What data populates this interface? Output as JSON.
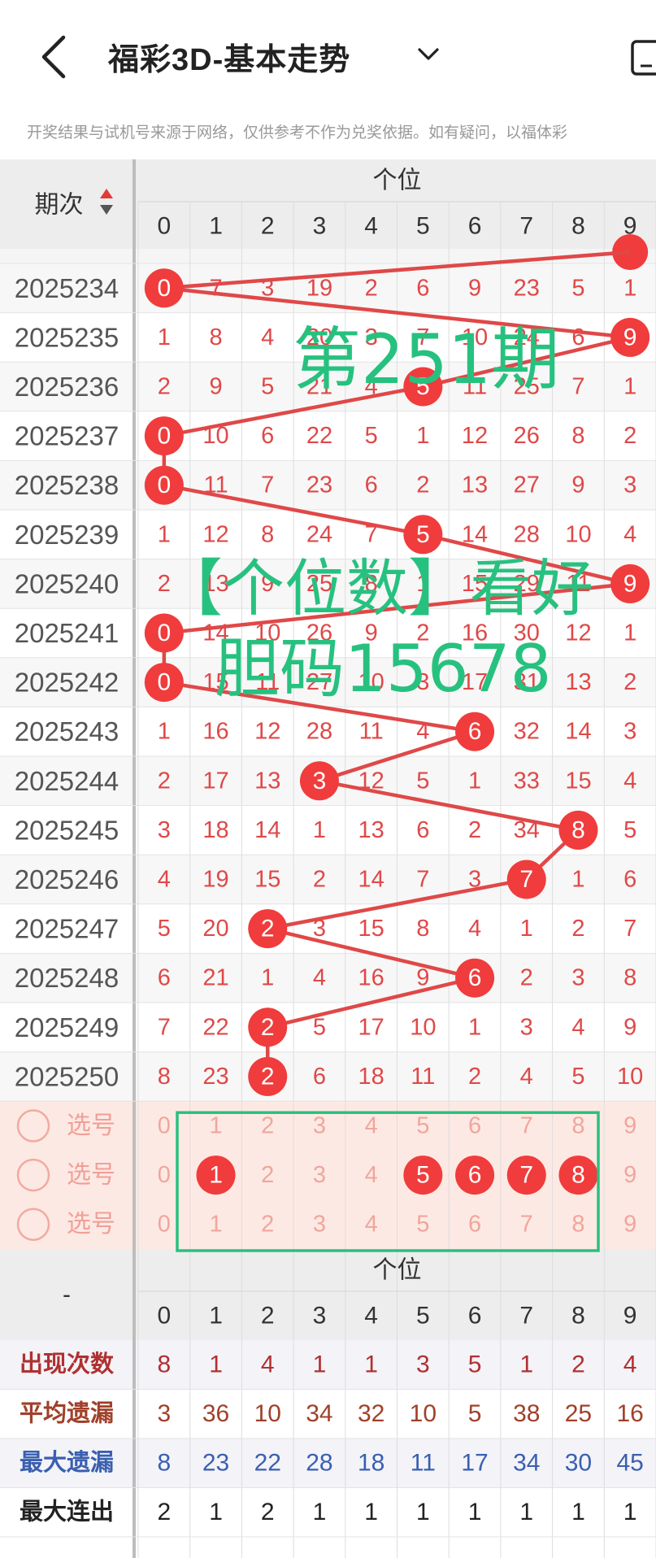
{
  "header": {
    "title": "福彩3D-基本走势",
    "disclaimer": "开奖结果与试机号来源于网络，仅供参考不作为兑奖依据。如有疑问，以福体彩"
  },
  "table": {
    "period_label": "期次",
    "group_label": "个位",
    "digits": [
      "0",
      "1",
      "2",
      "3",
      "4",
      "5",
      "6",
      "7",
      "8",
      "9"
    ],
    "rows": [
      {
        "period": "2025234",
        "cells": [
          "0",
          "7",
          "3",
          "19",
          "2",
          "6",
          "9",
          "23",
          "5",
          "1"
        ],
        "hit": 0
      },
      {
        "period": "2025235",
        "cells": [
          "1",
          "8",
          "4",
          "20",
          "3",
          "7",
          "10",
          "24",
          "6",
          "9"
        ],
        "hit": 9
      },
      {
        "period": "2025236",
        "cells": [
          "2",
          "9",
          "5",
          "21",
          "4",
          "5",
          "11",
          "25",
          "7",
          "1"
        ],
        "hit": 5
      },
      {
        "period": "2025237",
        "cells": [
          "0",
          "10",
          "6",
          "22",
          "5",
          "1",
          "12",
          "26",
          "8",
          "2"
        ],
        "hit": 0
      },
      {
        "period": "2025238",
        "cells": [
          "0",
          "11",
          "7",
          "23",
          "6",
          "2",
          "13",
          "27",
          "9",
          "3"
        ],
        "hit": 0
      },
      {
        "period": "2025239",
        "cells": [
          "1",
          "12",
          "8",
          "24",
          "7",
          "5",
          "14",
          "28",
          "10",
          "4"
        ],
        "hit": 5
      },
      {
        "period": "2025240",
        "cells": [
          "2",
          "13",
          "9",
          "25",
          "8",
          "1",
          "15",
          "29",
          "11",
          "9"
        ],
        "hit": 9
      },
      {
        "period": "2025241",
        "cells": [
          "0",
          "14",
          "10",
          "26",
          "9",
          "2",
          "16",
          "30",
          "12",
          "1"
        ],
        "hit": 0
      },
      {
        "period": "2025242",
        "cells": [
          "0",
          "15",
          "11",
          "27",
          "10",
          "3",
          "17",
          "31",
          "13",
          "2"
        ],
        "hit": 0
      },
      {
        "period": "2025243",
        "cells": [
          "1",
          "16",
          "12",
          "28",
          "11",
          "4",
          "6",
          "32",
          "14",
          "3"
        ],
        "hit": 6
      },
      {
        "period": "2025244",
        "cells": [
          "2",
          "17",
          "13",
          "3",
          "12",
          "5",
          "1",
          "33",
          "15",
          "4"
        ],
        "hit": 3
      },
      {
        "period": "2025245",
        "cells": [
          "3",
          "18",
          "14",
          "1",
          "13",
          "6",
          "2",
          "34",
          "8",
          "5"
        ],
        "hit": 8
      },
      {
        "period": "2025246",
        "cells": [
          "4",
          "19",
          "15",
          "2",
          "14",
          "7",
          "3",
          "7",
          "1",
          "6"
        ],
        "hit": 7
      },
      {
        "period": "2025247",
        "cells": [
          "5",
          "20",
          "2",
          "3",
          "15",
          "8",
          "4",
          "1",
          "2",
          "7"
        ],
        "hit": 2
      },
      {
        "period": "2025248",
        "cells": [
          "6",
          "21",
          "1",
          "4",
          "16",
          "9",
          "6",
          "2",
          "3",
          "8"
        ],
        "hit": 6
      },
      {
        "period": "2025249",
        "cells": [
          "7",
          "22",
          "2",
          "5",
          "17",
          "10",
          "1",
          "3",
          "4",
          "9"
        ],
        "hit": 2
      },
      {
        "period": "2025250",
        "cells": [
          "8",
          "23",
          "2",
          "6",
          "18",
          "11",
          "2",
          "4",
          "5",
          "10"
        ],
        "hit": 2
      }
    ],
    "select_label": "选号",
    "select_rows": [
      {
        "picked": []
      },
      {
        "picked": [
          1,
          5,
          6,
          7,
          8
        ]
      },
      {
        "picked": []
      }
    ],
    "stats_dash": "-",
    "stats": [
      {
        "label": "出现次数",
        "color": "#b03030",
        "values": [
          "8",
          "1",
          "4",
          "1",
          "1",
          "3",
          "5",
          "1",
          "2",
          "4"
        ]
      },
      {
        "label": "平均遗漏",
        "color": "#a0402a",
        "values": [
          "3",
          "36",
          "10",
          "34",
          "32",
          "10",
          "5",
          "38",
          "25",
          "16"
        ]
      },
      {
        "label": "最大遗漏",
        "color": "#3a5fb0",
        "values": [
          "8",
          "23",
          "22",
          "28",
          "18",
          "11",
          "17",
          "34",
          "30",
          "45"
        ]
      },
      {
        "label": "最大连出",
        "color": "#222222",
        "values": [
          "2",
          "1",
          "2",
          "1",
          "1",
          "1",
          "1",
          "1",
          "1",
          "1"
        ]
      }
    ]
  },
  "overlay": {
    "line1": "第251期",
    "line2": "【个位数】看好",
    "line3": "胆码15678"
  },
  "colors": {
    "ball": "#f03c3c",
    "miss_text": "#e04848",
    "line": "#e04848",
    "overlay_text": "#27c17f",
    "select_bg": "#fde9e4",
    "header_bg": "#ededed"
  },
  "icons": {
    "back": "chevron-left-icon",
    "dropdown": "chevron-down-icon",
    "device": "phone-icon",
    "sort": "sort-arrows-icon",
    "radio": "radio-circle-icon"
  }
}
